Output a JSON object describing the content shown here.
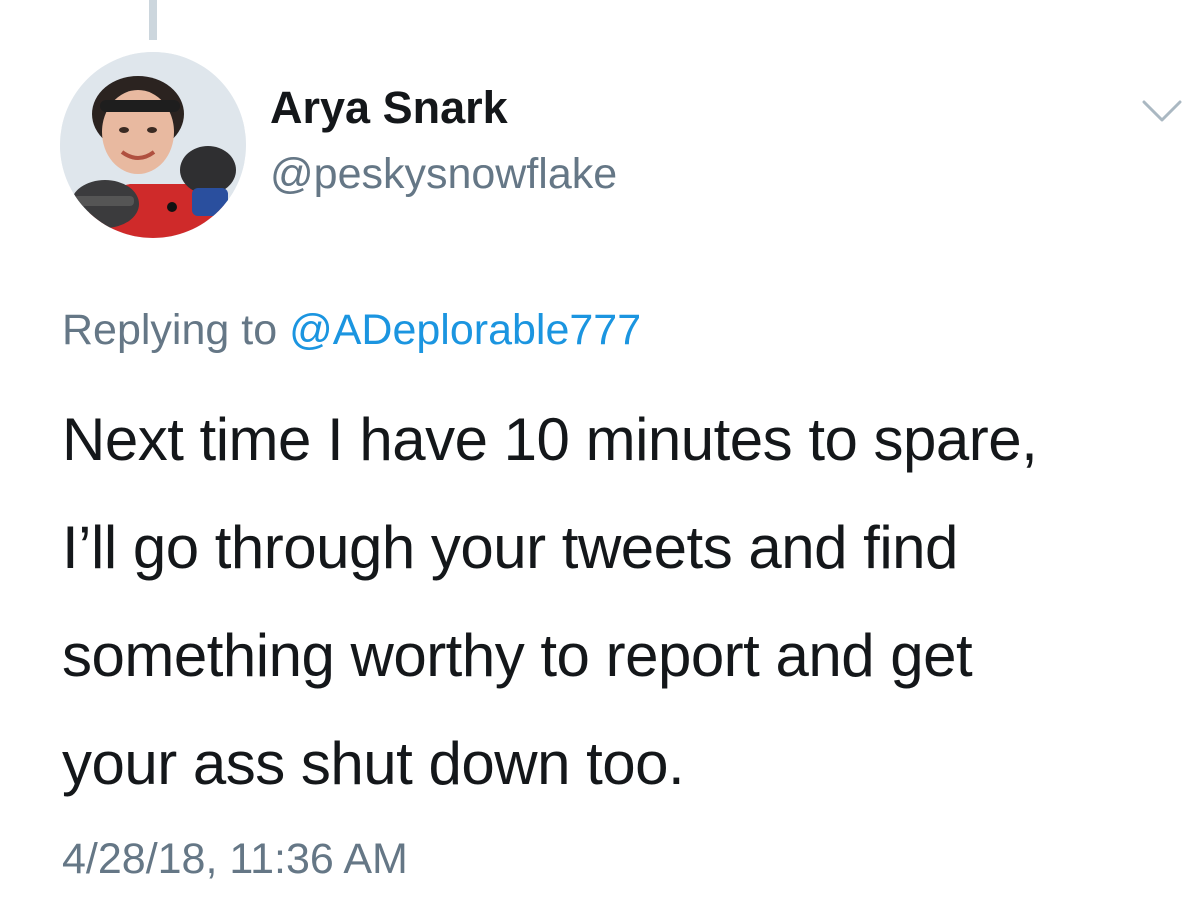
{
  "author": {
    "display_name": "Arya Snark",
    "handle": "@peskysnowflake"
  },
  "reply": {
    "prefix": "Replying to",
    "mention": "@ADeplorable777"
  },
  "tweet": {
    "lines": [
      "Next time I have 10 minutes to spare,",
      "I’ll go through your tweets and find",
      "something worthy to report and get",
      "your ass shut down too."
    ],
    "timestamp": "4/28/18, 11:36 AM"
  },
  "icons": {
    "menu": "chevron-down-icon"
  },
  "colors": {
    "text": "#14171a",
    "secondary": "#657786",
    "link": "#1b95e0",
    "thread_line": "#ccd6dd"
  }
}
